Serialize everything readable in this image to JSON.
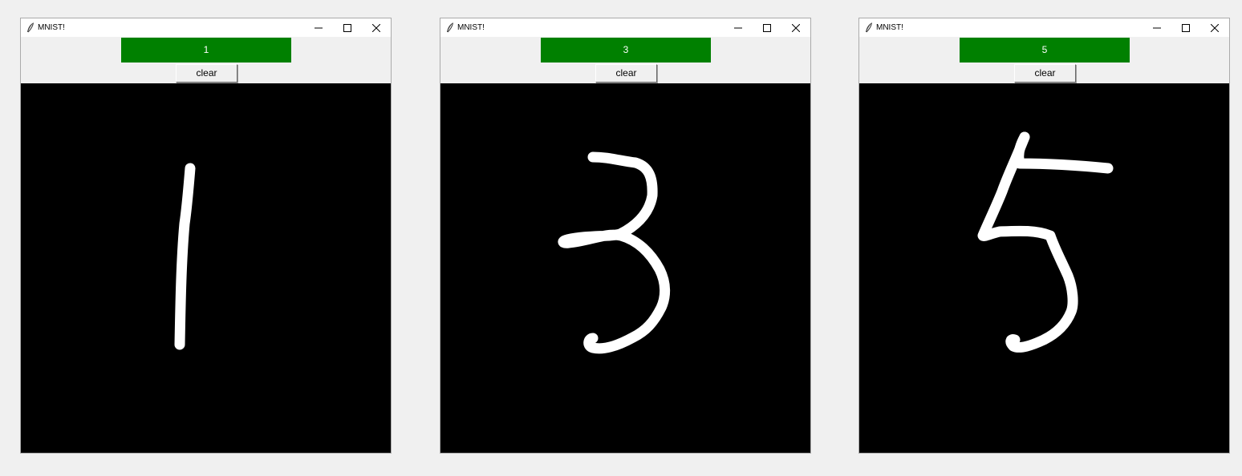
{
  "windows": [
    {
      "title": "MNIST!",
      "prediction": "1",
      "clear_label": "clear",
      "drawn_digit": "1",
      "icons": [
        "feather-icon",
        "minimize-icon",
        "maximize-icon",
        "close-icon"
      ]
    },
    {
      "title": "MNIST!",
      "prediction": "3",
      "clear_label": "clear",
      "drawn_digit": "3",
      "icons": [
        "feather-icon",
        "minimize-icon",
        "maximize-icon",
        "close-icon"
      ]
    },
    {
      "title": "MNIST!",
      "prediction": "5",
      "clear_label": "clear",
      "drawn_digit": "5",
      "icons": [
        "feather-icon",
        "minimize-icon",
        "maximize-icon",
        "close-icon"
      ]
    }
  ],
  "colors": {
    "prediction_bg": "#008000",
    "prediction_text": "#ffffff",
    "canvas_bg": "#000000",
    "stroke": "#ffffff",
    "window_bg": "#f0f0f0"
  }
}
